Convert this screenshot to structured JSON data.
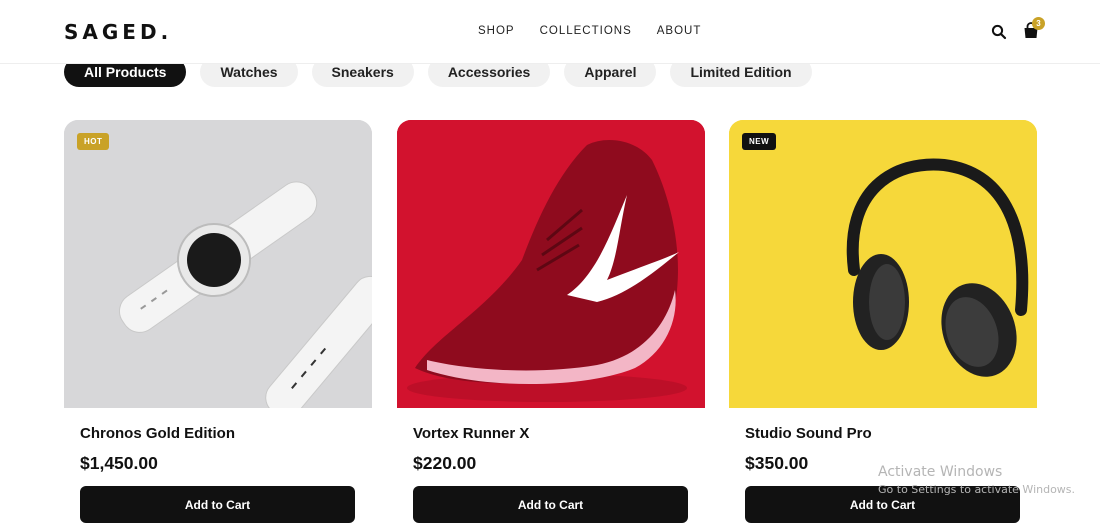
{
  "brand": {
    "logo": "SAGED."
  },
  "nav": {
    "items": [
      "SHOP",
      "COLLECTIONS",
      "ABOUT"
    ]
  },
  "header": {
    "cart_count": "3",
    "search_icon": "search-icon",
    "cart_icon": "shopping-bag-icon"
  },
  "filters": [
    "All Products",
    "Watches",
    "Sneakers",
    "Accessories",
    "Apparel",
    "Limited Edition"
  ],
  "products": [
    {
      "name": "Chronos Gold Edition",
      "price": "$1,450.00",
      "badge": "HOT",
      "button": "Add to Cart",
      "image": "white-smartwatch"
    },
    {
      "name": "Vortex Runner X",
      "price": "$220.00",
      "badge": "",
      "button": "Add to Cart",
      "image": "red-running-sneaker"
    },
    {
      "name": "Studio Sound Pro",
      "price": "$350.00",
      "badge": "NEW",
      "button": "Add to Cart",
      "image": "black-headphones"
    }
  ],
  "watermark": {
    "title": "Activate Windows",
    "subtitle": "Go to Settings to activate Windows."
  },
  "colors": {
    "accent_gold": "#c9a227",
    "dark": "#111111",
    "chip_bg": "#f1f1f1",
    "sneaker_bg": "#d2122e",
    "headphone_bg": "#f6d83a",
    "watch_bg": "#d7d7d9"
  }
}
